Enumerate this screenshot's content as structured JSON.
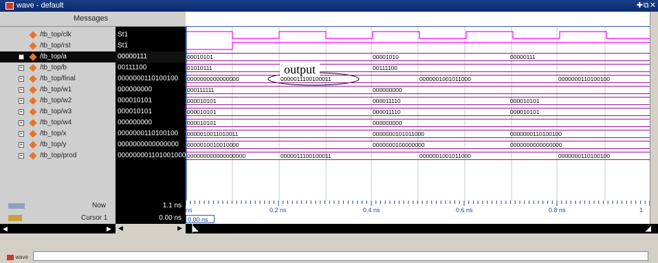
{
  "window": {
    "title": "wave - default"
  },
  "panes": {
    "messages_header": "Messages"
  },
  "signals": [
    {
      "name": "/tb_top/clk",
      "value": "St1"
    },
    {
      "name": "/tb_top/rst",
      "value": "St1"
    },
    {
      "name": "/tb_top/a",
      "value": "00000111",
      "selected": true
    },
    {
      "name": "/tb_top/b",
      "value": "00111100"
    },
    {
      "name": "/tb_top/final",
      "value": "0000000110100100"
    },
    {
      "name": "/tb_top/w1",
      "value": "000000000"
    },
    {
      "name": "/tb_top/w2",
      "value": "000010101"
    },
    {
      "name": "/tb_top/w3",
      "value": "000010101"
    },
    {
      "name": "/tb_top/w4",
      "value": "000000000"
    },
    {
      "name": "/tb_top/x",
      "value": "0000000110100100"
    },
    {
      "name": "/tb_top/y",
      "value": "0000000000000000"
    },
    {
      "name": "/tb_top/prod",
      "value": "000000001101001000"
    }
  ],
  "bus_labels": {
    "a": [
      "00010101",
      "00001010",
      "00000111"
    ],
    "b": [
      "01010111",
      "00111100"
    ],
    "final": [
      "0000000000000000",
      "0000011100100011",
      "0000001001011000",
      "0000000110100100"
    ],
    "w1": [
      "000111111",
      "000000000"
    ],
    "w2": [
      "000010101",
      "000011110",
      "000010101"
    ],
    "w3": [
      "000010101",
      "000011110",
      "000010101"
    ],
    "w4": [
      "000010101",
      "000000000"
    ],
    "x": [
      "0000010011010011",
      "0000000101011000",
      "0000000110100100"
    ],
    "y": [
      "0000010010010000",
      "0000000100000000",
      "0000000000000000"
    ],
    "prod": [
      "000000000000000000",
      "0000011100100011",
      "0000001001011000",
      "0000000110100100"
    ]
  },
  "annotation": {
    "text": "output"
  },
  "time": {
    "now_label": "Now",
    "now_value": "1.1 ns",
    "cursor_label": "Cursor 1",
    "cursor_value": "0.00 ns",
    "cursor_box": "0.00 ns",
    "ticks": [
      "ns",
      "0.2 ns",
      "0.4 ns",
      "0.6 ns",
      "0.8 ns",
      "1"
    ]
  },
  "footer": {
    "tab_label": "wave"
  },
  "colors": {
    "bus": "#9a0a9a",
    "clock": "#ff00ff",
    "signal_icon": "#e8742a"
  }
}
